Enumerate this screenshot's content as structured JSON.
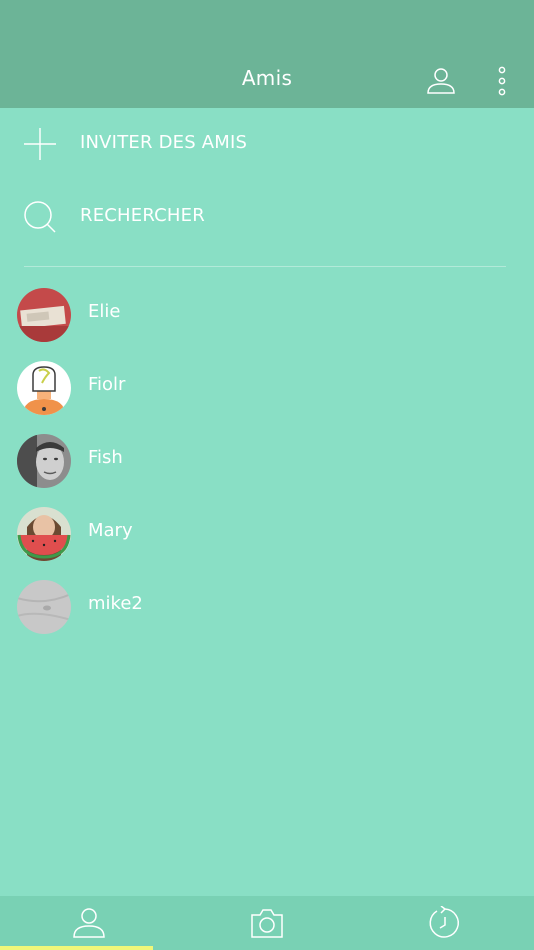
{
  "header": {
    "title": "Amis",
    "profile_icon": "user-icon",
    "menu_icon": "more-vertical-icon"
  },
  "actions": {
    "invite": {
      "label": "INVITER DES AMIS",
      "icon": "plus-icon"
    },
    "search": {
      "label": "RECHERCHER",
      "icon": "search-icon"
    }
  },
  "friends": [
    {
      "name": "Elie"
    },
    {
      "name": "Fiolr"
    },
    {
      "name": "Fish"
    },
    {
      "name": "Mary"
    },
    {
      "name": "mike2"
    }
  ],
  "tabbar": {
    "tabs": [
      {
        "icon": "user-icon",
        "selected": true
      },
      {
        "icon": "camera-icon",
        "selected": false
      },
      {
        "icon": "history-clock-icon",
        "selected": false
      }
    ],
    "indicator_color": "#f0f779"
  },
  "colors": {
    "background": "#89dfc5",
    "header": "#6cb497",
    "tabbar": "#79d1b4"
  }
}
